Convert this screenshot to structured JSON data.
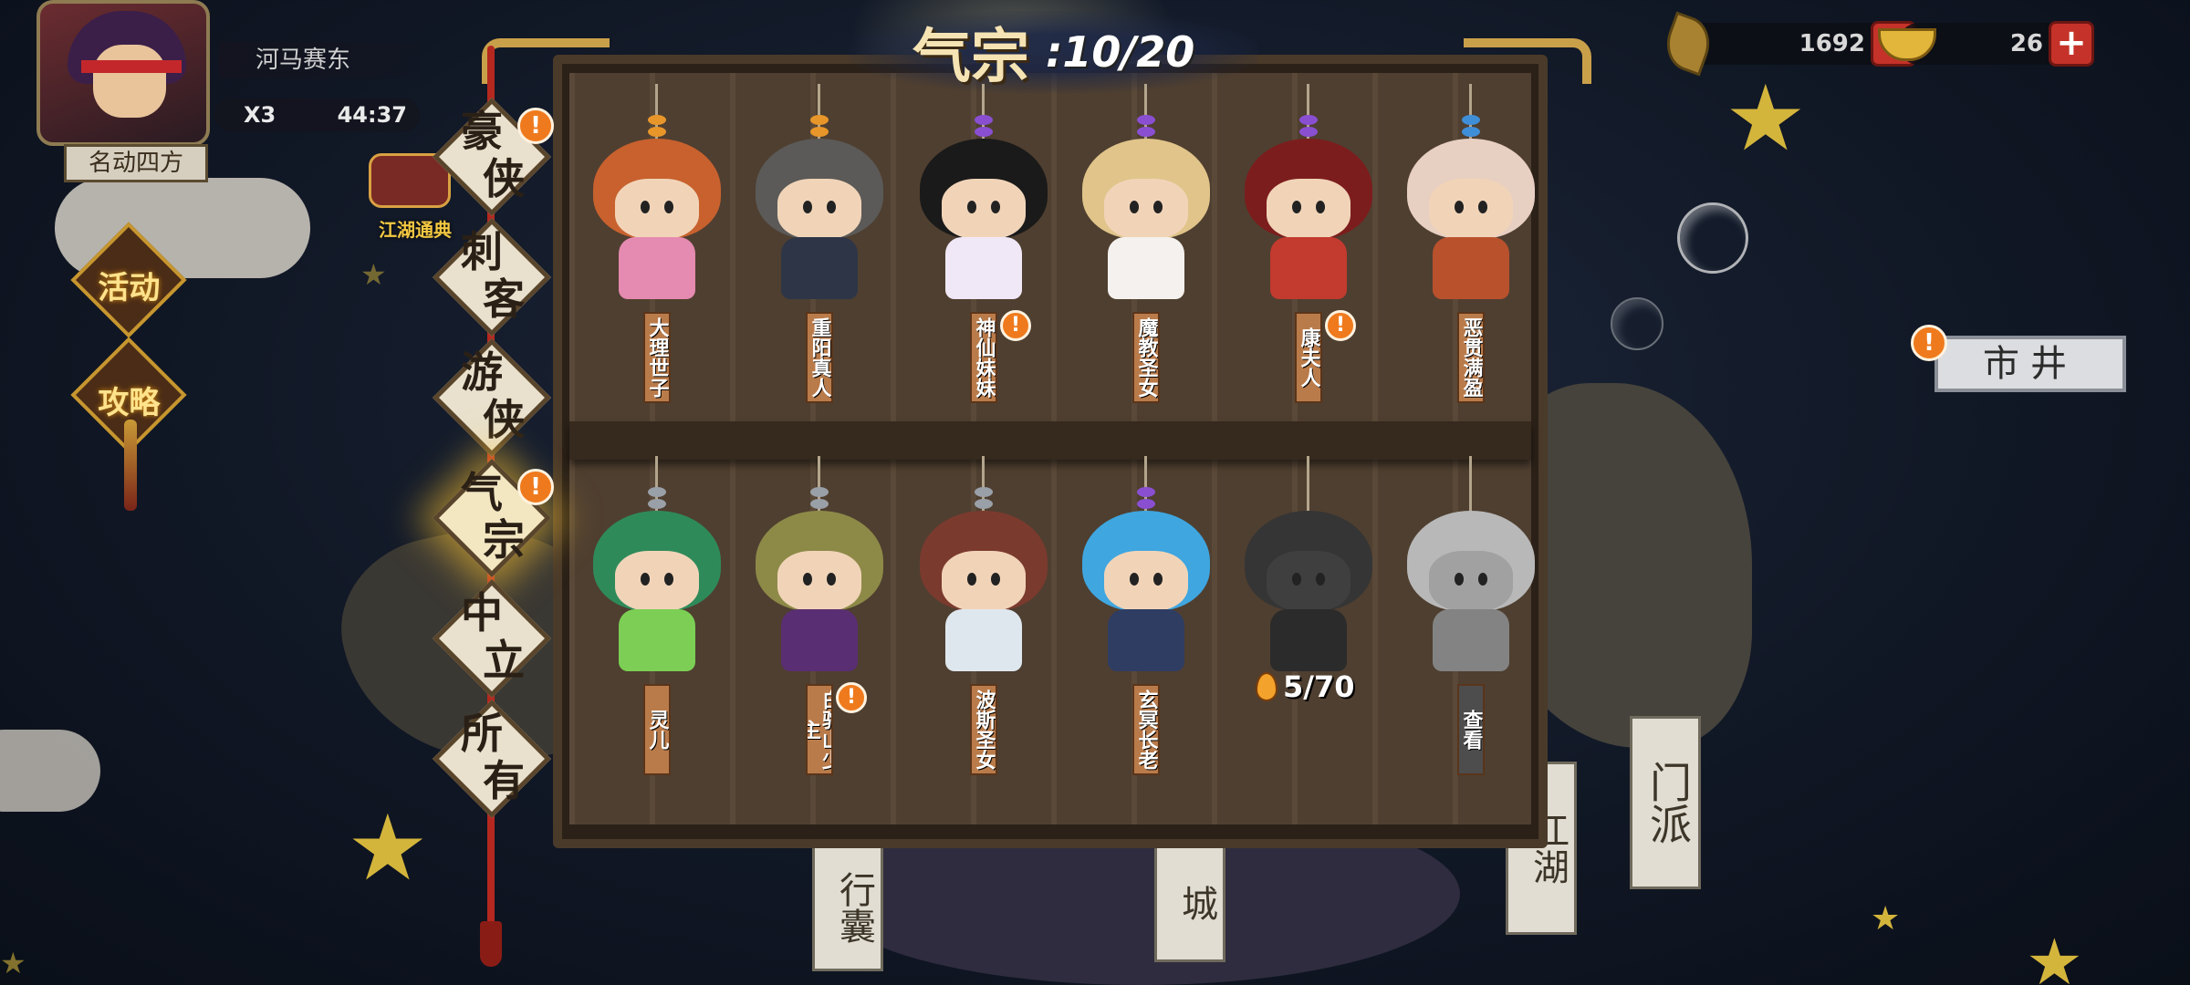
{
  "player": {
    "name": "河马赛东",
    "stamina_multiplier": "X3",
    "timer": "44:37",
    "title": "名动四方"
  },
  "side_menu": {
    "jianghu_label": "江湖通典",
    "activity_label": "活动",
    "strategy_label": "攻略"
  },
  "currency": {
    "leaves": "1692",
    "gold": "26",
    "plus": "+"
  },
  "market_label": "市井",
  "page_title": {
    "name": "气宗",
    "count": ":10/20"
  },
  "tabs": [
    {
      "label": "豪侠",
      "top": "豪",
      "bottom": "侠",
      "alert": "!"
    },
    {
      "label": "刺客",
      "top": "刺",
      "bottom": "客"
    },
    {
      "label": "游侠",
      "top": "游",
      "bottom": "侠"
    },
    {
      "label": "气宗",
      "top": "气",
      "bottom": "宗",
      "alert": "!",
      "active": true
    },
    {
      "label": "中立",
      "top": "中",
      "bottom": "立"
    },
    {
      "label": "所有",
      "top": "所",
      "bottom": "有"
    }
  ],
  "characters_top": [
    {
      "name": "大理世子"
    },
    {
      "name": "重阳真人"
    },
    {
      "name": "神仙妹妹",
      "alert": "!"
    },
    {
      "name": "魔教圣女"
    },
    {
      "name": "康夫人",
      "alert": "!"
    },
    {
      "name": "恶贯满盈"
    }
  ],
  "characters_bottom": [
    {
      "name": "灵儿"
    },
    {
      "name": "白驼山少主",
      "alert": "!"
    },
    {
      "name": "波斯圣女"
    },
    {
      "name": "玄冥长老"
    },
    {
      "name": "",
      "locked": true
    },
    {
      "name": "查看",
      "locked": true
    }
  ],
  "locked_progress": "5/70",
  "background_tablets": [
    "门派",
    "江湖",
    "行囊",
    "城"
  ],
  "colors": {
    "accent_gold": "#c9a04a",
    "alert_orange": "#ef7a1d",
    "plus_red": "#c53229"
  }
}
